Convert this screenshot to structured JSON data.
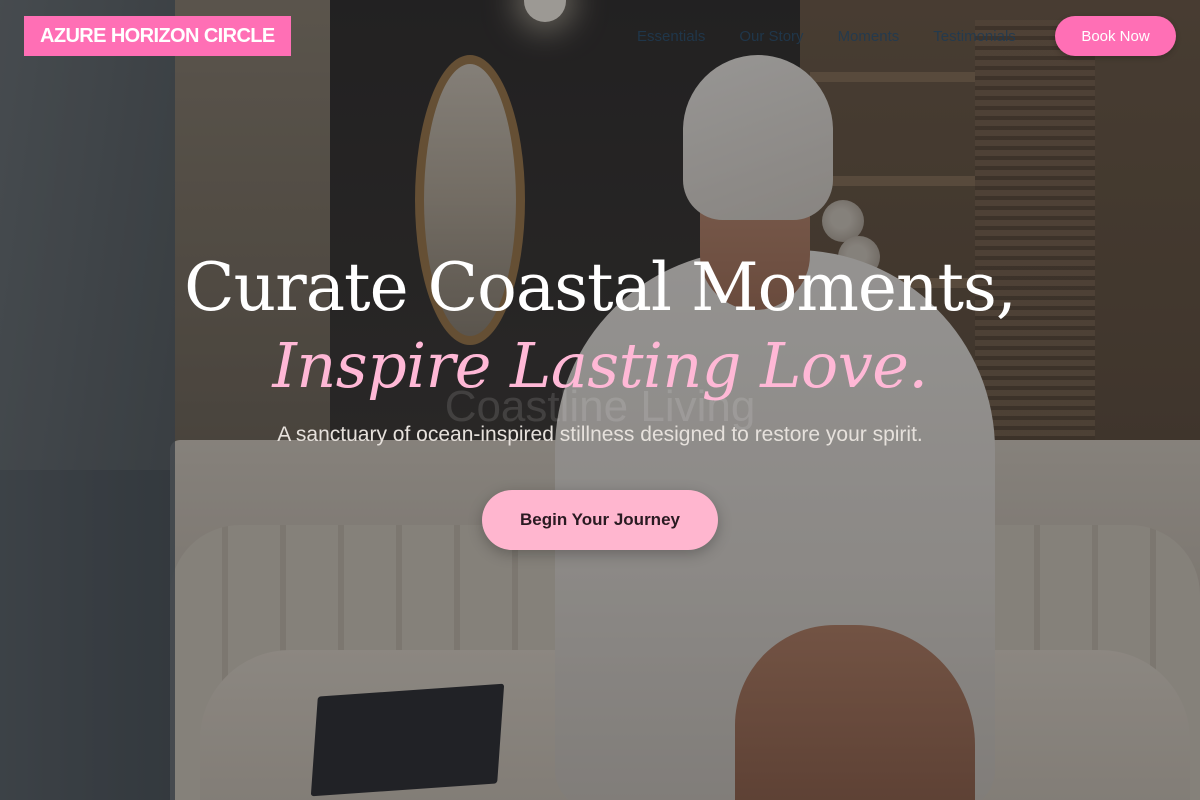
{
  "brand": {
    "logo_text": "AZURE HORIZON CIRCLE",
    "accent_color": "#ff6fb5"
  },
  "nav": {
    "links": [
      "Essentials",
      "Our Story",
      "Moments",
      "Testimonials"
    ],
    "book_label": "Book Now"
  },
  "hero": {
    "headline_line1": "Curate Coastal Moments,",
    "headline_line2": "Inspire Lasting Love.",
    "subtitle": "A sanctuary of ocean-inspired stillness designed to restore your spirit.",
    "cta_label": "Begin Your Journey",
    "watermark_text": "Coastline Living",
    "headline_accent_color": "#ffb8d6",
    "cta_color": "#ffb6cf"
  }
}
